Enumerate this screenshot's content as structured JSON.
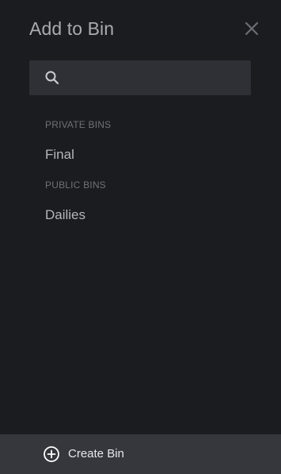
{
  "dialog": {
    "title": "Add to Bin",
    "close_icon": "close-icon"
  },
  "search": {
    "icon": "search-icon",
    "value": "",
    "placeholder": ""
  },
  "sections": [
    {
      "header": "PRIVATE BINS",
      "items": [
        "Final"
      ]
    },
    {
      "header": "PUBLIC BINS",
      "items": [
        "Dailies"
      ]
    }
  ],
  "footer": {
    "icon": "plus-circle-icon",
    "label": "Create Bin"
  },
  "colors": {
    "background": "#1b1c20",
    "search_background": "#2f3035",
    "footer_background": "#35373d",
    "section_header": "#6e7177",
    "item_text": "#b4b6bb"
  }
}
